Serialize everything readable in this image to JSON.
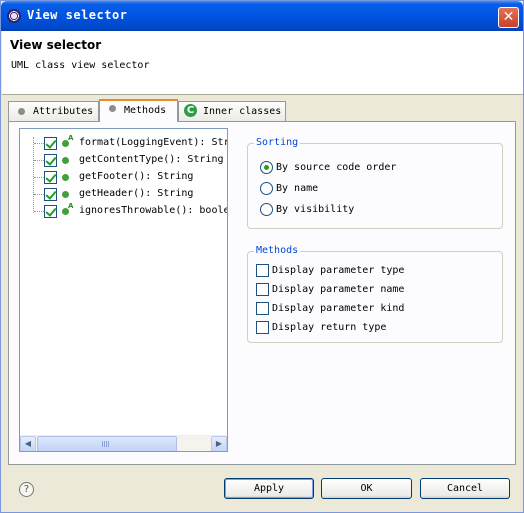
{
  "window": {
    "title": "View selector"
  },
  "header": {
    "title": "View selector",
    "message": "UML class view selector"
  },
  "tabs": [
    {
      "label": "Attributes",
      "icon": "attribute-dot-icon",
      "active": false
    },
    {
      "label": "Methods",
      "icon": "method-dot-icon",
      "active": true
    },
    {
      "label": "Inner classes",
      "icon": "class-c-icon",
      "active": false
    }
  ],
  "methods_list": [
    {
      "label": "format(LoggingEvent): Str",
      "checked": true,
      "abstract_marker": "A"
    },
    {
      "label": "getContentType(): String",
      "checked": true,
      "abstract_marker": ""
    },
    {
      "label": "getFooter(): String",
      "checked": true,
      "abstract_marker": ""
    },
    {
      "label": "getHeader(): String",
      "checked": true,
      "abstract_marker": ""
    },
    {
      "label": "ignoresThrowable(): boole",
      "checked": true,
      "abstract_marker": "A"
    }
  ],
  "sorting": {
    "label": "Sorting",
    "options": [
      {
        "label": "By source code order",
        "selected": true
      },
      {
        "label": "By name",
        "selected": false
      },
      {
        "label": "By visibility",
        "selected": false
      }
    ]
  },
  "methods_options": {
    "label": "Methods",
    "options": [
      {
        "label": "Display parameter type",
        "checked": false
      },
      {
        "label": "Display parameter name",
        "checked": false
      },
      {
        "label": "Display parameter kind",
        "checked": false
      },
      {
        "label": "Display return type",
        "checked": false
      }
    ]
  },
  "buttons": {
    "help": "?",
    "apply": "Apply",
    "ok": "OK",
    "cancel": "Cancel"
  },
  "close_glyph": "✕",
  "class_icon_glyph": "C",
  "scroll": {
    "left_arrow": "◀",
    "right_arrow": "▶"
  }
}
